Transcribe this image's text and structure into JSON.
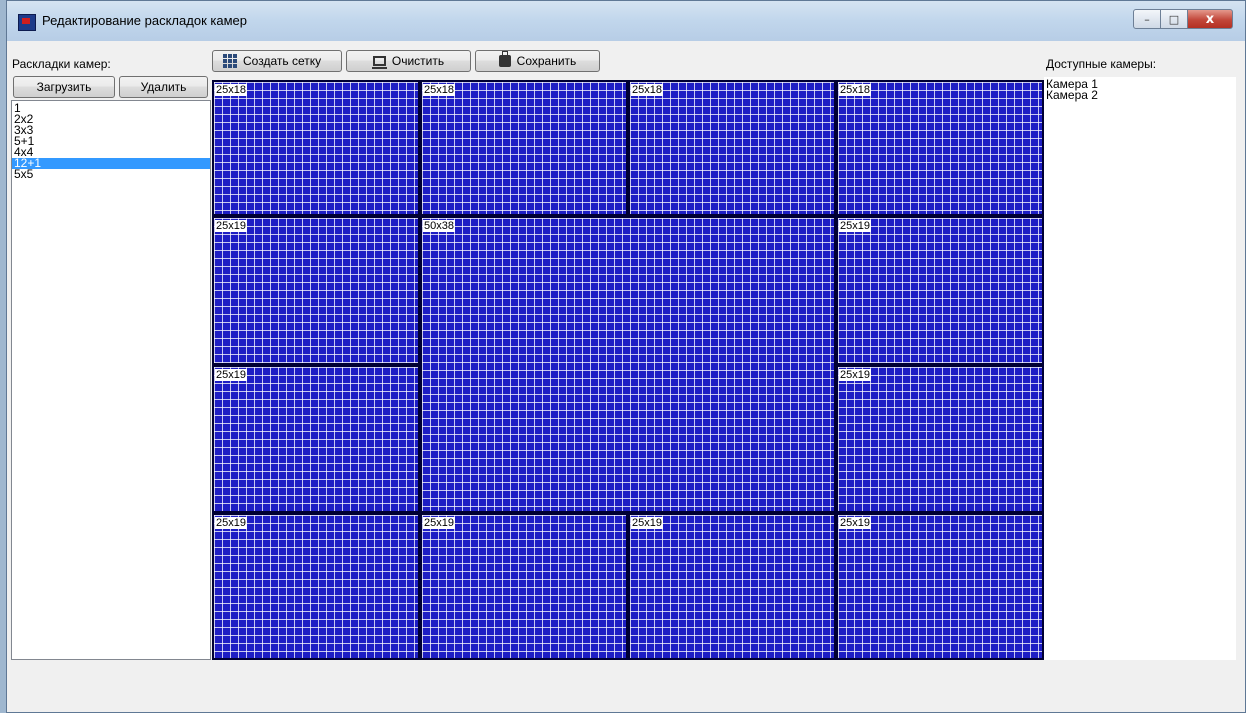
{
  "window": {
    "title": "Редактирование раскладок камер",
    "controls": {
      "minimize": "–",
      "maximize": "□",
      "close": "x"
    }
  },
  "left_panel": {
    "label": "Раскладки камер:",
    "load_button": "Загрузить",
    "delete_button": "Удалить",
    "layouts": [
      "1",
      "2x2",
      "3x3",
      "5+1",
      "4x4",
      "12+1",
      "5x5"
    ],
    "selected_layout": "12+1"
  },
  "toolbar": {
    "create_grid": "Создать сетку",
    "clear": "Очистить",
    "save": "Сохранить"
  },
  "grid": {
    "cells": [
      {
        "label": "25x18"
      },
      {
        "label": "25x18"
      },
      {
        "label": "25x18"
      },
      {
        "label": "25x18"
      },
      {
        "label": "25x19"
      },
      {
        "label": "50x38"
      },
      {
        "label": "25x19"
      },
      {
        "label": "25x19"
      },
      {
        "label": "25x19"
      },
      {
        "label": "25x19"
      },
      {
        "label": "25x19"
      },
      {
        "label": "25x19"
      },
      {
        "label": "25x19"
      }
    ]
  },
  "right_panel": {
    "label": "Доступные камеры:",
    "cameras": [
      "Камера 1",
      "Камера 2"
    ]
  },
  "colors": {
    "cell_fill": "#1e1ec4",
    "grid_lines": "#ffffff",
    "selection": "#3399ff"
  }
}
